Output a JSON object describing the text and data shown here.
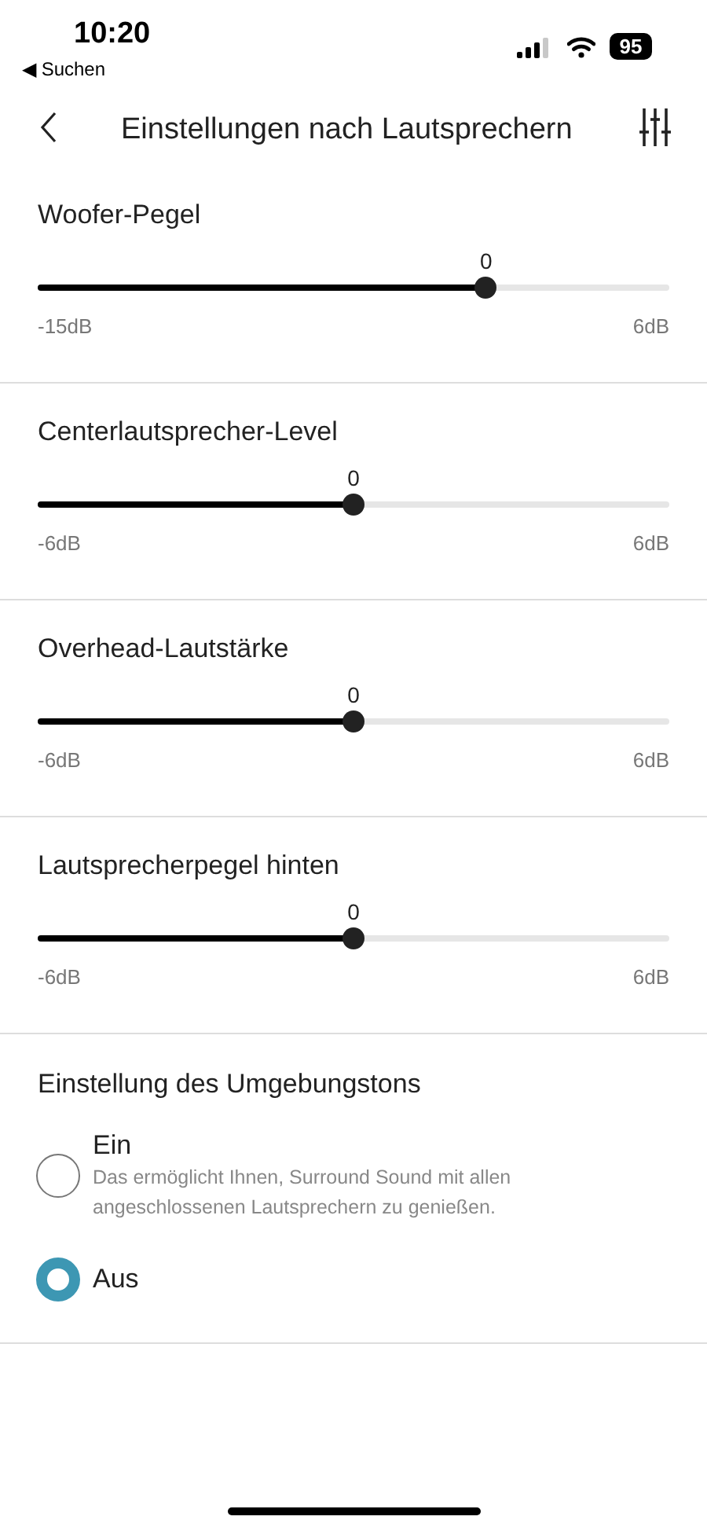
{
  "status_bar": {
    "time": "10:20",
    "back_link": "◀ Suchen",
    "battery": "95"
  },
  "header": {
    "title": "Einstellungen nach Lautsprechern"
  },
  "sliders": [
    {
      "label": "Woofer-Pegel",
      "value": "0",
      "level": 0.71,
      "min_label": "-15dB",
      "max_label": "6dB"
    },
    {
      "label": "Centerlautsprecher-Level",
      "value": "0",
      "level": 0.5,
      "min_label": "-6dB",
      "max_label": "6dB"
    },
    {
      "label": "Overhead-Lautstärke",
      "value": "0",
      "level": 0.5,
      "min_label": "-6dB",
      "max_label": "6dB"
    },
    {
      "label": "Lautsprecherpegel hinten",
      "value": "0",
      "level": 0.5,
      "min_label": "-6dB",
      "max_label": "6dB"
    }
  ],
  "surround": {
    "title": "Einstellung des Umgebungstons",
    "options": [
      {
        "label": "Ein",
        "description": "Das ermöglicht Ihnen, Surround Sound mit allen angeschlossenen Lautsprechern zu genießen.",
        "selected": false
      },
      {
        "label": "Aus",
        "selected": true
      }
    ]
  }
}
